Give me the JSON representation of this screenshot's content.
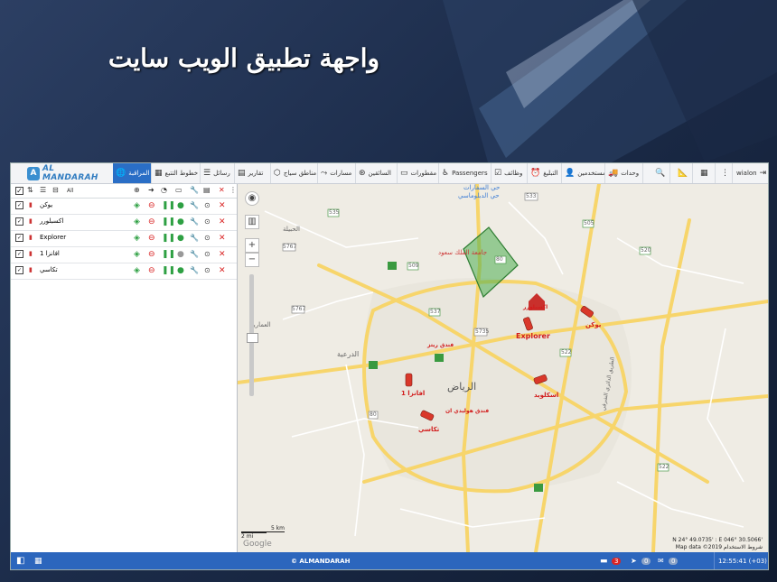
{
  "slide": {
    "title": "واجهة تطبيق الويب سايت"
  },
  "app": {
    "logo_text": "AL MANDARAH",
    "topbar": {
      "items": [
        {
          "label": "wialon",
          "icon": "logout-icon"
        },
        {
          "label": "",
          "icon": "menu-dots-icon"
        },
        {
          "label": "",
          "icon": "apps-grid-icon"
        },
        {
          "label": "",
          "icon": "measure-icon"
        },
        {
          "label": "",
          "icon": "search-icon"
        },
        {
          "label": "وحدات",
          "icon": "truck-icon"
        },
        {
          "label": "مستخدمين",
          "icon": "user-icon"
        },
        {
          "label": "التبليغ",
          "icon": "alarm-icon"
        },
        {
          "label": "وظائف",
          "icon": "clipboard-icon"
        },
        {
          "label": "Passengers",
          "icon": "passenger-icon"
        },
        {
          "label": "مقطورات",
          "icon": "trailer-icon"
        },
        {
          "label": "السائقين",
          "icon": "steering-icon"
        },
        {
          "label": "مسارات",
          "icon": "route-icon"
        },
        {
          "label": "مناطق سياج",
          "icon": "geofence-icon"
        },
        {
          "label": "تقارير",
          "icon": "report-icon"
        },
        {
          "label": "رسائل",
          "icon": "messages-icon"
        },
        {
          "label": "خطوط التتبع",
          "icon": "tracks-icon"
        },
        {
          "label": "المراقبة",
          "icon": "globe-icon"
        }
      ]
    },
    "sidebar": {
      "all_label": "All",
      "units": [
        {
          "name": "يوكن"
        },
        {
          "name": "اكسبلورر"
        },
        {
          "name": "Explorer"
        },
        {
          "name": "افانزا 1"
        },
        {
          "name": "تكاسي"
        }
      ]
    },
    "map": {
      "places": {
        "diplomatic": "حي السفارات",
        "diplomatic2": "حي الدبلوماسي",
        "hubla": "الحبيلة",
        "diriyah": "الدرعية",
        "ammariya": "العمارية",
        "riyadh": "الرياض",
        "ksu": "جامعة الملك سعود",
        "hwy": "طريق الملك فهد",
        "eastern": "الطريق الدائري الشرقي"
      },
      "unit_labels": {
        "yukon": "يوكن",
        "explorer": "Explorer",
        "explorer_ar": "اكسبلورر",
        "avanza": "افانزا 1",
        "taxi": "تكاسي",
        "escalade": "اسكلويد",
        "hotel1": "فندق ريتز",
        "hotel2": "فندق هوليدي ان"
      },
      "roads": [
        "535",
        "5767",
        "5767",
        "509",
        "537",
        "5735",
        "80",
        "522",
        "520",
        "505",
        "533",
        "522",
        "80"
      ],
      "scale_km": "5 km",
      "scale_mi": "2 mi",
      "provider": "Google",
      "coords": "N 24° 49.0735' : E 046° 30.5066'",
      "map_data": "Map data ©2019  شروط الاستخدام"
    },
    "statusbar": {
      "copyright": "© ALMANDARAH",
      "notif_count": "3",
      "count2": "0",
      "count3": "0",
      "time": "12:55:41 (+03)"
    }
  }
}
